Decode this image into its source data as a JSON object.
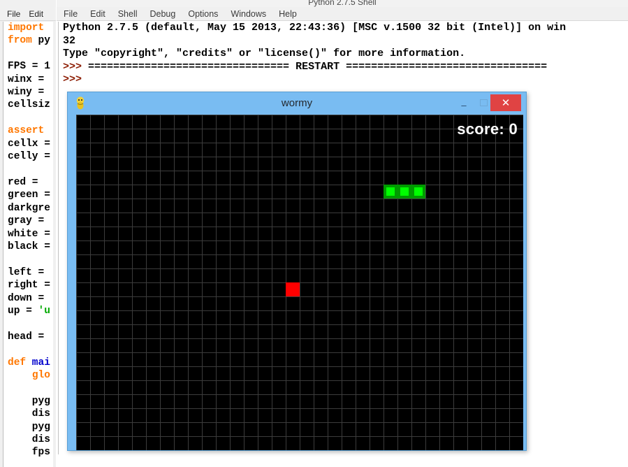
{
  "editor_window": {
    "menu": [
      "File",
      "Edit"
    ],
    "code_lines": [
      {
        "text": "import",
        "type": "keyword"
      },
      {
        "text": "from py",
        "type": "keyword-mixed",
        "kw": "from",
        "rest": " py"
      },
      {
        "text": "",
        "type": "blank"
      },
      {
        "text": "FPS = 1",
        "type": "plain"
      },
      {
        "text": "winx = ",
        "type": "plain"
      },
      {
        "text": "winy = ",
        "type": "plain"
      },
      {
        "text": "cellsiz",
        "type": "plain"
      },
      {
        "text": "",
        "type": "blank"
      },
      {
        "text": "assert",
        "type": "keyword"
      },
      {
        "text": "cellx =",
        "type": "plain"
      },
      {
        "text": "celly =",
        "type": "plain"
      },
      {
        "text": "",
        "type": "blank"
      },
      {
        "text": "red =",
        "type": "plain"
      },
      {
        "text": "green =",
        "type": "plain"
      },
      {
        "text": "darkgre",
        "type": "plain"
      },
      {
        "text": "gray =",
        "type": "plain"
      },
      {
        "text": "white =",
        "type": "plain"
      },
      {
        "text": "black =",
        "type": "plain"
      },
      {
        "text": "",
        "type": "blank"
      },
      {
        "text": "left =",
        "type": "plain"
      },
      {
        "text": "right =",
        "type": "plain"
      },
      {
        "text": "down =",
        "type": "plain"
      },
      {
        "text": "up = 'u",
        "type": "plain-str",
        "plain": "up = ",
        "str": "'u"
      },
      {
        "text": "",
        "type": "blank"
      },
      {
        "text": "head =",
        "type": "plain"
      },
      {
        "text": "",
        "type": "blank"
      },
      {
        "text": "def mai",
        "type": "def",
        "kw": "def",
        "name": " mai"
      },
      {
        "text": "    glo",
        "type": "indent-kw",
        "indent": "    ",
        "kw": "glo"
      },
      {
        "text": "",
        "type": "blank"
      },
      {
        "text": "    pyg",
        "type": "plain"
      },
      {
        "text": "    dis",
        "type": "plain"
      },
      {
        "text": "    pyg",
        "type": "plain"
      },
      {
        "text": "    dis",
        "type": "plain"
      },
      {
        "text": "    fps",
        "type": "plain"
      }
    ]
  },
  "shell_window": {
    "title": "Python 2.7.5 Shell",
    "menu": [
      "File",
      "Edit",
      "Shell",
      "Debug",
      "Options",
      "Windows",
      "Help"
    ],
    "lines": [
      {
        "kind": "output",
        "text": "Python 2.7.5 (default, May 15 2013, 22:43:36) [MSC v.1500 32 bit (Intel)] on win "
      },
      {
        "kind": "output",
        "text": "32"
      },
      {
        "kind": "output",
        "text": "Type \"copyright\", \"credits\" or \"license()\" for more information."
      },
      {
        "kind": "restart",
        "prompt": ">>> ",
        "text": "================================ RESTART ================================"
      },
      {
        "kind": "prompt",
        "prompt": ">>> ",
        "text": ""
      }
    ]
  },
  "wormy_window": {
    "title": "wormy",
    "icon": "python-icon",
    "minimize_glyph": "–",
    "maximize_glyph": "□",
    "close_glyph": "✕",
    "score_label": "score: 0",
    "score_value": 0,
    "board": {
      "cols": 32,
      "rows": 24,
      "cell_size": 20,
      "bg_color": "#000000",
      "grid_color": "#3c3c3c"
    },
    "worm": {
      "color_border": "#009a00",
      "color_inner": "#00ff00",
      "segments": [
        {
          "col": 22,
          "row": 5
        },
        {
          "col": 23,
          "row": 5
        },
        {
          "col": 24,
          "row": 5
        }
      ]
    },
    "apple": {
      "color": "#ff0000",
      "col": 15,
      "row": 12
    }
  },
  "colors": {
    "shell_prompt": "#8b1a00",
    "keyword": "#ff7700",
    "function_name": "#0000cc",
    "string": "#00aa00",
    "window_chrome": "#79bcf2",
    "close_button": "#e04343"
  }
}
